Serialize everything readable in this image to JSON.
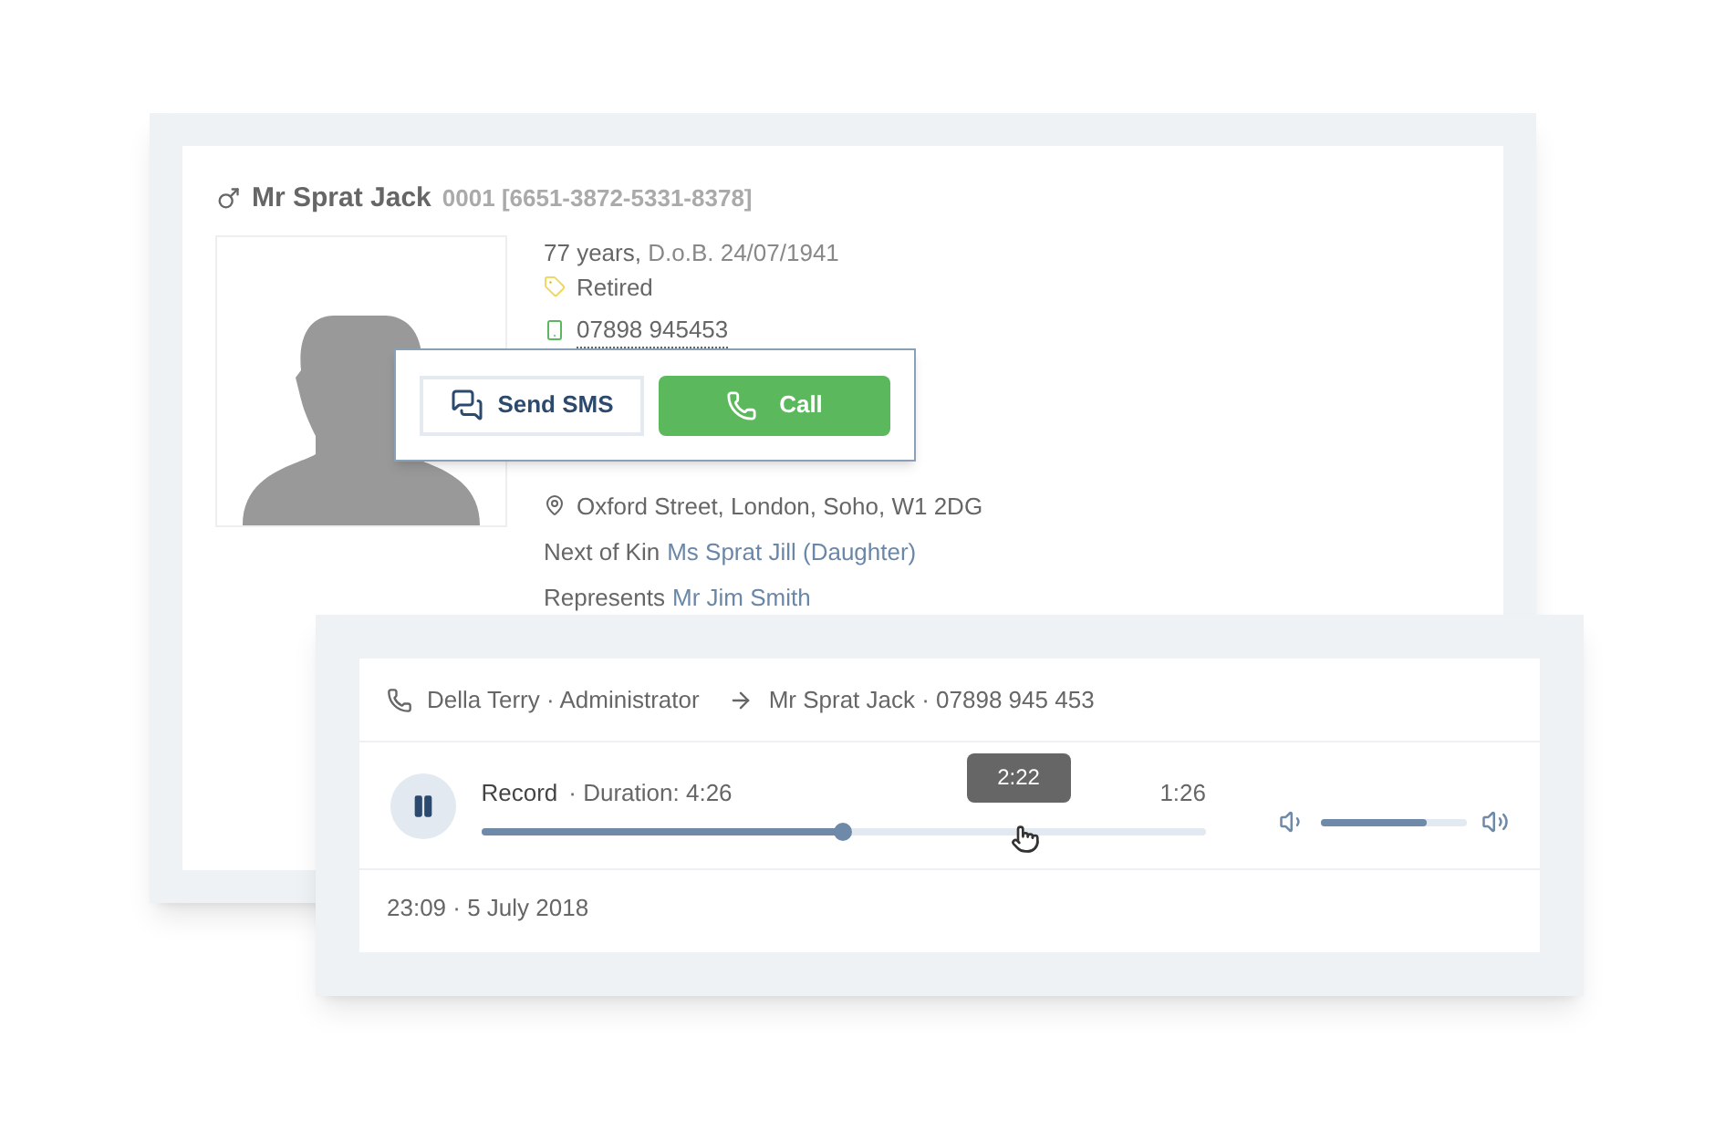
{
  "patient": {
    "name": "Mr Sprat Jack",
    "id": "0001",
    "code": "[6651-3872-5331-8378]",
    "age": "77 years,",
    "dob": "D.o.B. 24/07/1941",
    "status": "Retired",
    "phone": "07898 945453",
    "address": "Oxford Street, London, Soho, W1 2DG",
    "kin_label": "Next of Kin",
    "kin": "Ms Sprat Jill (Daughter)",
    "represents_label": "Represents",
    "represents": "Mr Jim Smith"
  },
  "popover": {
    "sms": "Send SMS",
    "call": "Call"
  },
  "call_record": {
    "from": "Della Terry · Administrator",
    "to": "Mr Sprat Jack · 07898 945 453",
    "title": "Record",
    "duration": "· Duration: 4:26",
    "remaining": "1:26",
    "level": 0.5,
    "hover_time": "2:22",
    "volume": {
      "level": 0.73
    },
    "playing": true,
    "date": "23:09 · 5 July 2018"
  }
}
